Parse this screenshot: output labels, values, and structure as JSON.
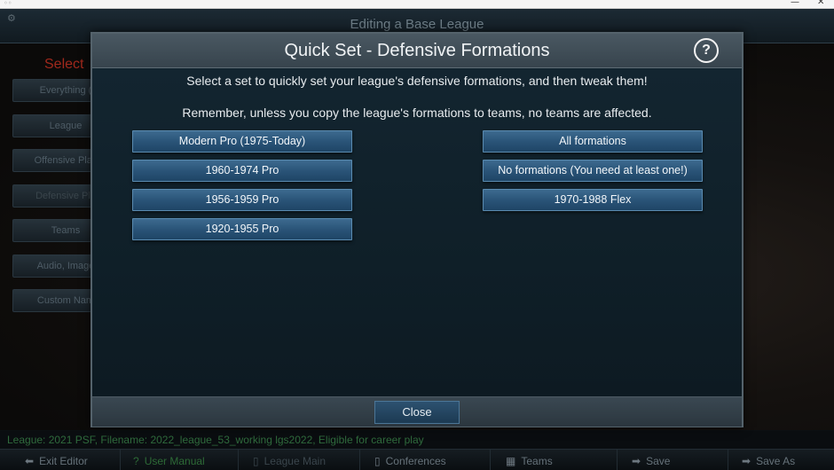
{
  "window": {
    "minimize_glyph": "—",
    "maximize_glyph": "□",
    "close_glyph": "✕"
  },
  "app": {
    "header_title": "Editing a Base League",
    "select_label": "Select",
    "sidebar": [
      {
        "label": "Everything (",
        "dim": false
      },
      {
        "label": "League",
        "dim": false
      },
      {
        "label": "Offensive Play",
        "dim": false
      },
      {
        "label": "Defensive Pla",
        "dim": true
      },
      {
        "label": "Teams",
        "dim": false
      },
      {
        "label": "Audio, Image",
        "dim": false
      },
      {
        "label": "Custom Nam",
        "dim": false
      }
    ],
    "footer_info": "League: 2021 PSF,  Filename: 2022_league_53_working lgs2022,  Eligible for career play",
    "footer_buttons": [
      {
        "label": "Exit Editor",
        "icon": "arrow-left-icon"
      },
      {
        "label": "User Manual",
        "icon": "help-circle-icon"
      },
      {
        "label": "League Main",
        "icon": "trash-icon"
      },
      {
        "label": "Conferences",
        "icon": "trash-icon"
      },
      {
        "label": "Teams",
        "icon": "grid-icon"
      },
      {
        "label": "Save",
        "icon": "arrow-right-icon"
      },
      {
        "label": "Save As",
        "icon": "arrow-right-icon"
      }
    ]
  },
  "modal": {
    "title": "Quick Set - Defensive Formations",
    "help_glyph": "?",
    "message_1": "Select a set to quickly set your league's defensive formations, and then tweak them!",
    "message_2": "Remember, unless you copy the league's formations to teams, no teams are affected.",
    "left_buttons": [
      "Modern Pro (1975-Today)",
      "1960-1974 Pro",
      "1956-1959 Pro",
      "1920-1955 Pro"
    ],
    "right_buttons": [
      "All formations",
      "No formations (You need at least one!)",
      "1970-1988 Flex"
    ],
    "close_label": "Close"
  },
  "colors": {
    "accent_button": "#2a5478",
    "modal_bg": "#0f1c24",
    "select_label": "#a0281c",
    "footer_info": "#2f6a3c"
  }
}
